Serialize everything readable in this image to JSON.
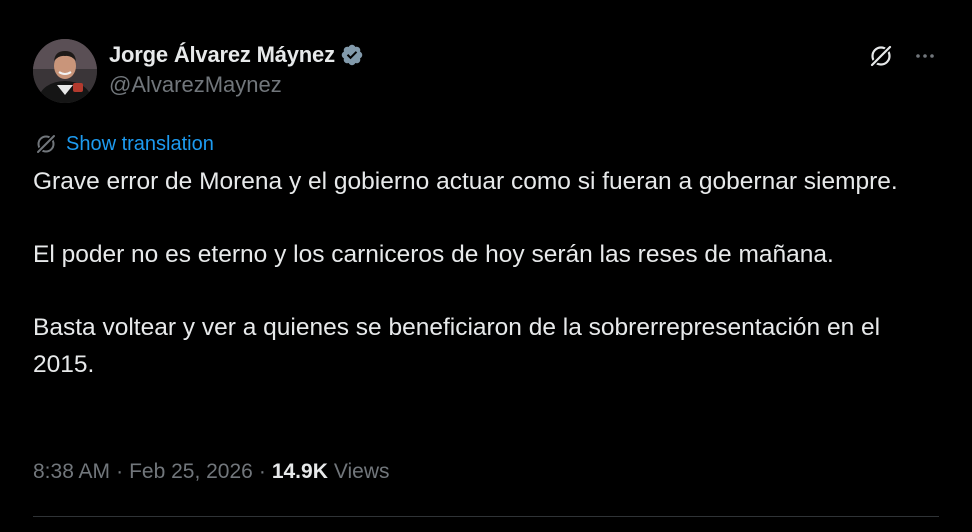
{
  "author": {
    "display_name": "Jorge Álvarez Máynez",
    "handle": "@AlvarezMaynez",
    "verified": true,
    "avatar_icon": "profile-photo"
  },
  "actions": {
    "grok_icon": "grok-icon",
    "more_icon": "more-horizontal-icon"
  },
  "translation": {
    "label": "Show translation",
    "icon": "grok-translate-icon"
  },
  "tweet": {
    "paragraphs": [
      "Grave error de Morena y el gobierno actuar como si fueran a gobernar siempre.",
      "El poder no es eterno y los carniceros de hoy serán las reses de mañana.",
      "Basta voltear y ver a quienes se beneficiaron de la sobrerrepresentación en el 2015."
    ]
  },
  "meta": {
    "time": "8:38 AM",
    "separator": "·",
    "date": "Feb 25, 2026",
    "views_count": "14.9K",
    "views_label": "Views"
  },
  "colors": {
    "background": "#000000",
    "text": "#e7e9ea",
    "secondary": "#71767b",
    "accent": "#1d9bf0",
    "divider": "#2f3336"
  }
}
